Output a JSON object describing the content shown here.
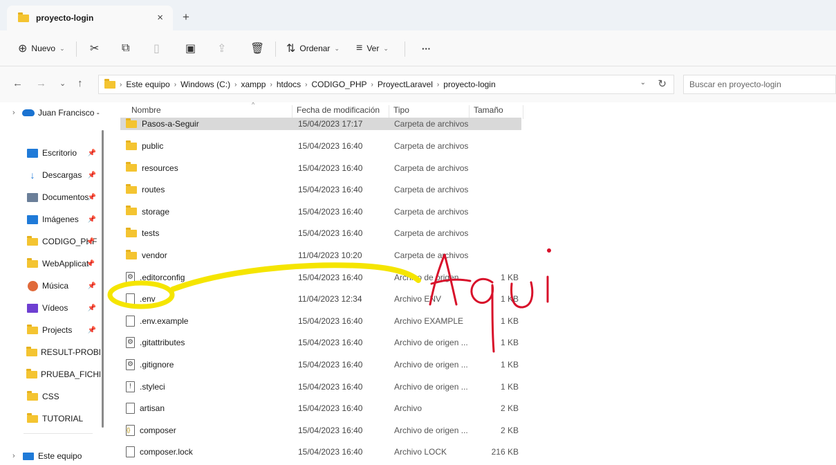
{
  "window": {
    "tab_title": "proyecto-login",
    "tab_close": "×",
    "new_tab": "+"
  },
  "commandbar": {
    "new_label": "Nuevo",
    "sort_label": "Ordenar",
    "view_label": "Ver",
    "more_label": "···"
  },
  "address": {
    "crumbs": [
      "Este equipo",
      "Windows (C:)",
      "xampp",
      "htdocs",
      "CODIGO_PHP",
      "ProyectLaravel",
      "proyecto-login"
    ],
    "search_placeholder": "Buscar en proyecto-login"
  },
  "sidebar": {
    "onedrive_label": "Juan Francisco -",
    "quick_access": [
      {
        "label": "Escritorio",
        "icon": "desktop-icon",
        "color": "#1f7ad8"
      },
      {
        "label": "Descargas",
        "icon": "download-icon",
        "color": "#1f7ad8"
      },
      {
        "label": "Documentos",
        "icon": "documents-icon",
        "color": "#6b7f99"
      },
      {
        "label": "Imágenes",
        "icon": "pictures-icon",
        "color": "#1f7ad8"
      },
      {
        "label": "CODIGO_PHF",
        "icon": "folder-icon",
        "color": "#f4c431"
      },
      {
        "label": "WebApplicat",
        "icon": "folder-icon",
        "color": "#f4c431"
      },
      {
        "label": "Música",
        "icon": "music-icon",
        "color": "#e06a3b"
      },
      {
        "label": "Vídeos",
        "icon": "videos-icon",
        "color": "#6e3fd1"
      },
      {
        "label": "Projects",
        "icon": "folder-icon",
        "color": "#f4c431"
      },
      {
        "label": "RESULT-PROBLE",
        "icon": "folder-icon",
        "color": "#f4c431"
      },
      {
        "label": "PRUEBA_FICHER",
        "icon": "folder-icon",
        "color": "#f4c431"
      },
      {
        "label": "CSS",
        "icon": "folder-icon",
        "color": "#f4c431"
      },
      {
        "label": "TUTORIAL",
        "icon": "folder-icon",
        "color": "#f4c431"
      }
    ],
    "this_pc_label": "Este equipo"
  },
  "columns": {
    "name": "Nombre",
    "date": "Fecha de modificación",
    "type": "Tipo",
    "size": "Tamaño"
  },
  "files": [
    {
      "name": "Pasos-a-Seguir",
      "date": "15/04/2023 17:17",
      "type": "Carpeta de archivos",
      "size": "",
      "icon": "folder-icon"
    },
    {
      "name": "public",
      "date": "15/04/2023 16:40",
      "type": "Carpeta de archivos",
      "size": "",
      "icon": "folder-icon"
    },
    {
      "name": "resources",
      "date": "15/04/2023 16:40",
      "type": "Carpeta de archivos",
      "size": "",
      "icon": "folder-icon"
    },
    {
      "name": "routes",
      "date": "15/04/2023 16:40",
      "type": "Carpeta de archivos",
      "size": "",
      "icon": "folder-icon"
    },
    {
      "name": "storage",
      "date": "15/04/2023 16:40",
      "type": "Carpeta de archivos",
      "size": "",
      "icon": "folder-icon"
    },
    {
      "name": "tests",
      "date": "15/04/2023 16:40",
      "type": "Carpeta de archivos",
      "size": "",
      "icon": "folder-icon"
    },
    {
      "name": "vendor",
      "date": "11/04/2023 10:20",
      "type": "Carpeta de archivos",
      "size": "",
      "icon": "folder-icon"
    },
    {
      "name": ".editorconfig",
      "date": "15/04/2023 16:40",
      "type": "Archivo de origen ...",
      "size": "1 KB",
      "icon": "config-file-icon"
    },
    {
      "name": ".env",
      "date": "11/04/2023 12:34",
      "type": "Archivo ENV",
      "size": "1 KB",
      "icon": "file-icon"
    },
    {
      "name": ".env.example",
      "date": "15/04/2023 16:40",
      "type": "Archivo EXAMPLE",
      "size": "1 KB",
      "icon": "file-icon"
    },
    {
      "name": ".gitattributes",
      "date": "15/04/2023 16:40",
      "type": "Archivo de origen ...",
      "size": "1 KB",
      "icon": "config-file-icon"
    },
    {
      "name": ".gitignore",
      "date": "15/04/2023 16:40",
      "type": "Archivo de origen ...",
      "size": "1 KB",
      "icon": "config-file-icon"
    },
    {
      "name": ".styleci",
      "date": "15/04/2023 16:40",
      "type": "Archivo de origen ...",
      "size": "1 KB",
      "icon": "styleci-file-icon"
    },
    {
      "name": "artisan",
      "date": "15/04/2023 16:40",
      "type": "Archivo",
      "size": "2 KB",
      "icon": "file-icon"
    },
    {
      "name": "composer",
      "date": "15/04/2023 16:40",
      "type": "Archivo de origen ...",
      "size": "2 KB",
      "icon": "json-file-icon"
    },
    {
      "name": "composer.lock",
      "date": "15/04/2023 16:40",
      "type": "Archivo LOCK",
      "size": "216 KB",
      "icon": "file-icon"
    }
  ],
  "annotation": {
    "text": "Aqui",
    "highlight_color": "#f5e500",
    "ink_color": "#d8102a"
  }
}
